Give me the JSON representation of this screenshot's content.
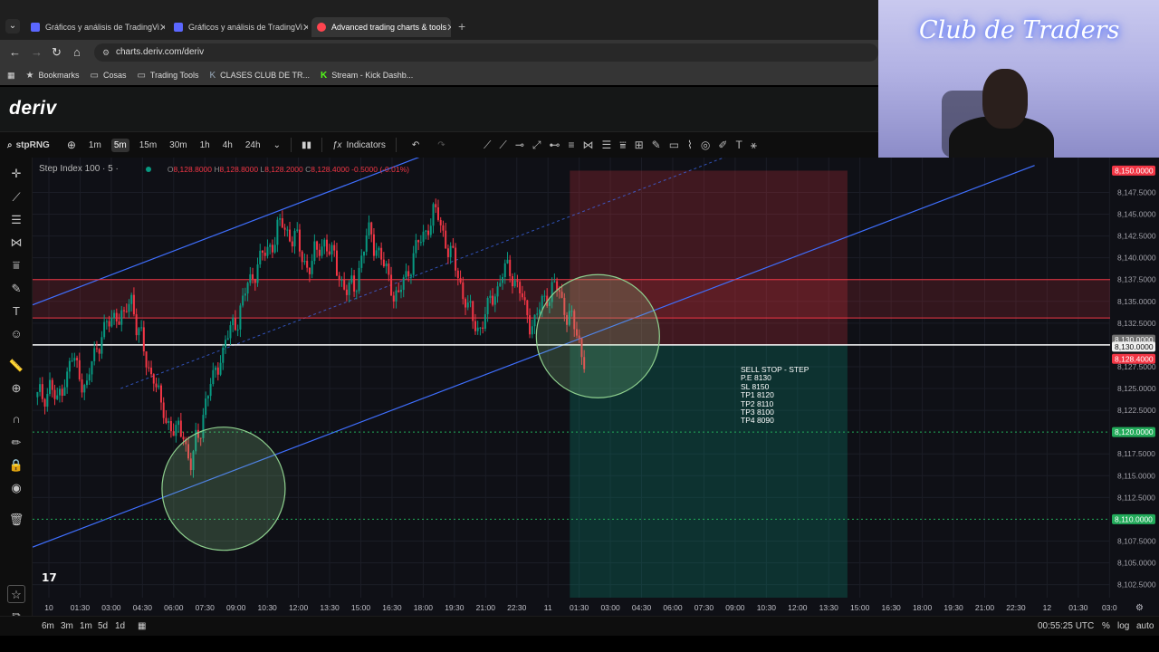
{
  "browser": {
    "tabs": [
      {
        "title": "Gráficos y análisis de TradingVi",
        "icon": "tradingview-icon",
        "active": false
      },
      {
        "title": "Gráficos y análisis de TradingVi",
        "icon": "tradingview-icon",
        "active": false
      },
      {
        "title": "Advanced trading charts & tools",
        "icon": "deriv-icon",
        "active": true
      }
    ],
    "url": "charts.deriv.com/deriv",
    "bookmarks": [
      {
        "label": "Bookmarks",
        "icon": "star-icon"
      },
      {
        "label": "Cosas",
        "icon": "folder-icon"
      },
      {
        "label": "Trading Tools",
        "icon": "folder-icon"
      },
      {
        "label": "CLASES CLUB DE TR...",
        "icon": "k-icon"
      },
      {
        "label": "Stream - Kick Dashb...",
        "icon": "kick-icon"
      }
    ]
  },
  "brand": {
    "logo": "deriv"
  },
  "webcam": {
    "neon_text": "Club de Traders"
  },
  "toolbar": {
    "symbol": "stpRNG",
    "timeframes": [
      "1m",
      "5m",
      "15m",
      "30m",
      "1h",
      "4h",
      "24h"
    ],
    "active_timeframe": "5m",
    "indicators_label": "Indicators"
  },
  "legend": {
    "title": "Step Index 100 · 5 ·",
    "open_label": "O",
    "open": "8,128.8000",
    "high_label": "H",
    "high": "8,128.8000",
    "low_label": "L",
    "low": "8,128.2000",
    "close_label": "C",
    "close": "8,128.4000",
    "change": "-0.5000 (-0.01%)"
  },
  "chart_data": {
    "type": "candlestick",
    "price_axis": {
      "ticks": [
        "8,147.5000",
        "8,145.0000",
        "8,142.5000",
        "8,140.0000",
        "8,137.5000",
        "8,135.0000",
        "8,132.5000",
        "8,127.5000",
        "8,125.0000",
        "8,122.5000",
        "8,117.5000",
        "8,115.0000",
        "8,112.5000",
        "8,107.5000",
        "8,105.0000",
        "8,102.5000"
      ],
      "tick_values": [
        8147.5,
        8145,
        8142.5,
        8140,
        8137.5,
        8135,
        8132.5,
        8127.5,
        8125,
        8122.5,
        8117.5,
        8115,
        8112.5,
        8107.5,
        8105,
        8102.5
      ],
      "range": [
        8101,
        8151.5
      ],
      "badges": [
        {
          "text": "8,150.0000",
          "value": 8150,
          "color": "#f23645"
        },
        {
          "text": "8,130.0000",
          "value": 8130.6,
          "color": "#707070"
        },
        {
          "text": "8,130.0000",
          "value": 8129.8,
          "color": "#f0f0f0"
        },
        {
          "text": "8,128.4000",
          "value": 8128.4,
          "color": "#f23645"
        },
        {
          "text": "8,120.0000",
          "value": 8120,
          "color": "#22ab5a"
        },
        {
          "text": "8,110.0000",
          "value": 8110,
          "color": "#22ab5a"
        }
      ]
    },
    "time_axis": [
      "10",
      "01:30",
      "03:00",
      "04:30",
      "06:00",
      "07:30",
      "09:00",
      "10:30",
      "12:00",
      "13:30",
      "15:00",
      "16:30",
      "18:00",
      "19:30",
      "21:00",
      "22:30",
      "11",
      "01:30",
      "03:00",
      "04:30",
      "06:00",
      "07:30",
      "09:00",
      "10:30",
      "12:00",
      "13:30",
      "15:00",
      "16:30",
      "18:00",
      "19:30",
      "21:00",
      "22:30",
      "12",
      "01:30",
      "03:0"
    ],
    "levels": [
      {
        "name": "zone-top",
        "value": 8137.5,
        "color": "#f23645"
      },
      {
        "name": "zone-bottom",
        "value": 8133.1,
        "color": "#f23645"
      },
      {
        "name": "entry",
        "value": 8130,
        "color": "#ffffff"
      },
      {
        "name": "tp-1",
        "value": 8120,
        "color": "#22ab5a",
        "dotted": true
      },
      {
        "name": "tp-2",
        "value": 8110,
        "color": "#22ab5a",
        "dotted": true
      }
    ],
    "position": {
      "type": "short",
      "entry": 8130,
      "stop": 8150,
      "target": 8100
    },
    "candles_close": [
      8124,
      8125.5,
      8123,
      8126,
      8128.5,
      8127,
      8125,
      8129,
      8131,
      8132.5,
      8134,
      8133,
      8135.5,
      8131,
      8128,
      8126.5,
      8123,
      8121,
      8119.5,
      8120,
      8116,
      8120,
      8123.5,
      8126,
      8128.5,
      8131,
      8133,
      8135,
      8137.5,
      8139,
      8140.5,
      8142,
      8144,
      8143,
      8142,
      8140,
      8139,
      8141,
      8142,
      8140,
      8138,
      8136,
      8137,
      8140,
      8143,
      8141,
      8139,
      8137,
      8135.5,
      8138,
      8140,
      8142,
      8144,
      8145.5,
      8143,
      8140,
      8138,
      8135,
      8133,
      8132,
      8134,
      8136,
      8138,
      8139,
      8137,
      8134,
      8132,
      8134,
      8136,
      8137,
      8135,
      8133,
      8131,
      8128.4
    ],
    "annotations": [
      {
        "type": "circle",
        "center_time_index": 5.6,
        "center_value": 8113.5,
        "color": "#8fd18f"
      },
      {
        "type": "circle",
        "center_time_index": 17.6,
        "center_value": 8131,
        "color": "#8fd18f"
      }
    ]
  },
  "trade_note": [
    "SELL STOP - STEP",
    "P.E 8130",
    "SL 8150",
    "TP1 8120",
    "TP2 8110",
    "TP3 8100",
    "TP4 8090"
  ],
  "bottom": {
    "ranges": [
      "6m",
      "3m",
      "1m",
      "5d",
      "1d"
    ],
    "clock": "00:55:25 UTC",
    "percent": "%",
    "log": "log",
    "auto": "auto"
  }
}
